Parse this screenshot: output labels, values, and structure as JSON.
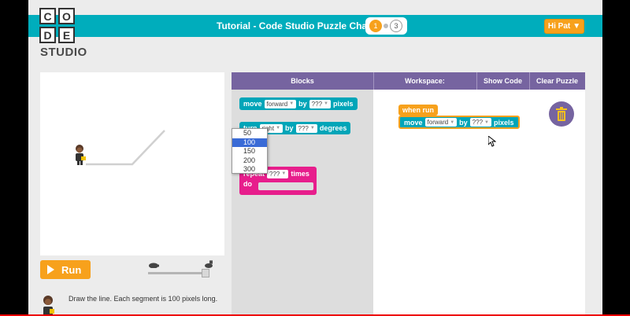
{
  "header": {
    "logo_letters": [
      "C",
      "O",
      "D",
      "E"
    ],
    "logo_studio": "STUDIO",
    "title": "Tutorial - Code Studio Puzzle Challenge",
    "progress": {
      "current": "1",
      "total": "3"
    },
    "user_button": "Hi Pat",
    "user_caret": "▼",
    "accent": "#00adbc"
  },
  "play": {
    "run_label": "Run",
    "speed_level": 0.95,
    "instruction": "Draw the line. Each segment is 100 pixels long."
  },
  "panel": {
    "blocks_label": "Blocks",
    "workspace_label": "Workspace:",
    "show_code_label": "Show Code",
    "clear_label": "Clear Puzzle"
  },
  "toolbox": {
    "move": {
      "text": "move",
      "direction": "forward",
      "by": "by",
      "amount": "???",
      "unit": "pixels"
    },
    "turn": {
      "text": "turn",
      "direction": "right",
      "by": "by",
      "amount": "???",
      "unit": "degrees"
    },
    "repeat": {
      "text": "repeat",
      "amount": "???",
      "unit": "times",
      "do": "do"
    }
  },
  "workspace": {
    "when_run": "when run",
    "move": {
      "text": "move",
      "direction": "forward",
      "by": "by",
      "amount": "???",
      "unit": "pixels"
    },
    "dropdown_options": [
      "50",
      "100",
      "150",
      "200",
      "300"
    ],
    "dropdown_selected": "100"
  },
  "colors": {
    "teal_block": "#00a5b8",
    "pink_block": "#e71e8c",
    "orange": "#f7a11c",
    "panel_purple": "#7664a0"
  }
}
